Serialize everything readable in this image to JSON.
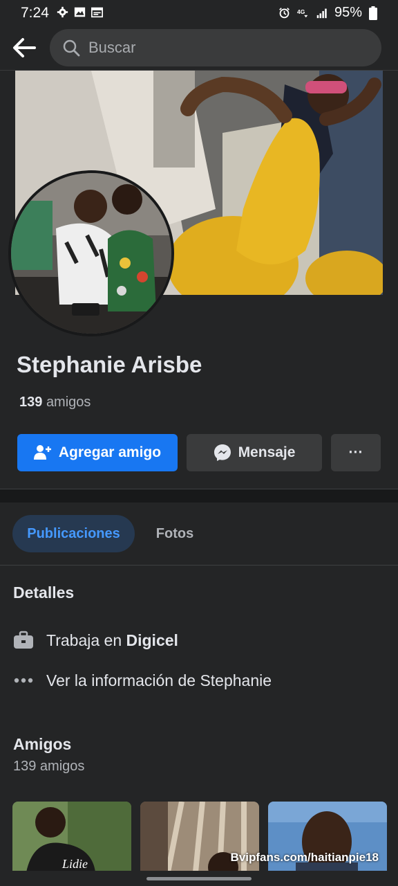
{
  "status_bar": {
    "time": "7:24",
    "battery": "95%"
  },
  "search": {
    "placeholder": "Buscar"
  },
  "profile": {
    "name": "Stephanie Arisbe",
    "friends_count": "139",
    "friends_word": "amigos"
  },
  "actions": {
    "add_friend": "Agregar amigo",
    "message": "Mensaje",
    "more": "···"
  },
  "tabs": [
    {
      "label": "Publicaciones"
    },
    {
      "label": "Fotos"
    }
  ],
  "details": {
    "title": "Detalles",
    "work_prefix": "Trabaja en",
    "work_place": "Digicel",
    "see_info": "Ver la información de Stephanie"
  },
  "friends_section": {
    "title": "Amigos",
    "subtitle": "139 amigos"
  },
  "watermark": "Bvipfans.com/haitianpie18",
  "colors": {
    "accent": "#1877f2",
    "bg": "#242526",
    "tab_active_bg": "#263951",
    "tab_active_text": "#4599ff"
  }
}
